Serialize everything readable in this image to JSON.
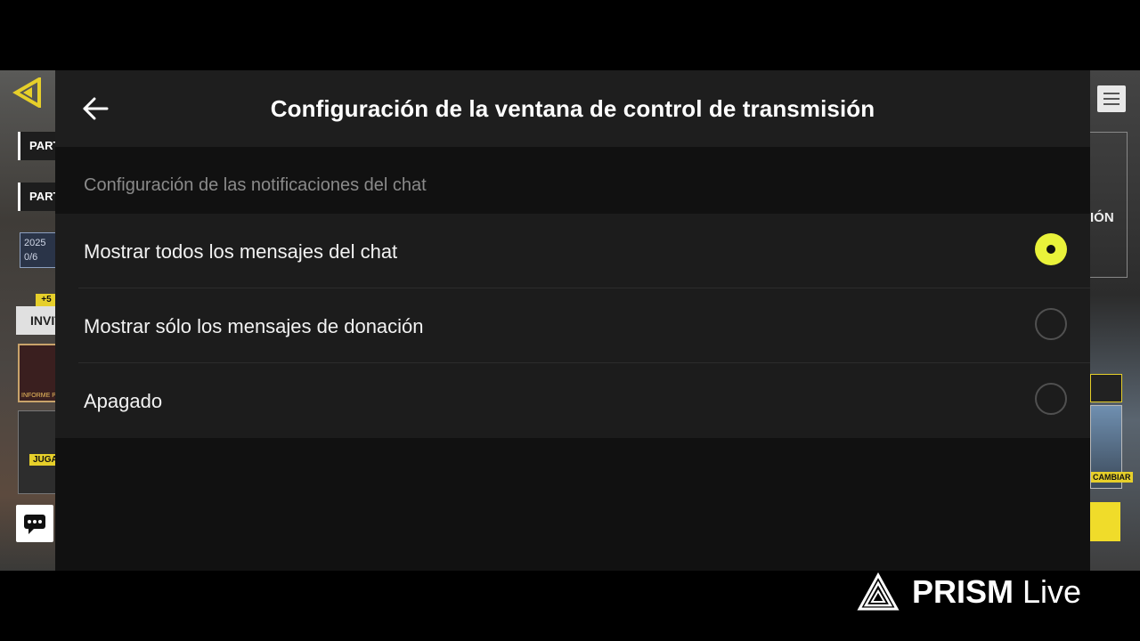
{
  "header": {
    "title": "Configuración de la ventana de control de transmisión",
    "back_icon": "arrow-left-icon"
  },
  "section": {
    "label": "Configuración de las notificaciones del chat"
  },
  "options": [
    {
      "label": "Mostrar todos los mensajes del chat",
      "selected": true
    },
    {
      "label": "Mostrar sólo los mensajes de donación",
      "selected": false
    },
    {
      "label": "Apagado",
      "selected": false
    }
  ],
  "colors": {
    "accent": "#e9f23a",
    "panel_bg": "#111111",
    "header_bg": "#1e1e1e",
    "row_bg": "#1c1c1c"
  },
  "background_game": {
    "left": {
      "pill_1": "PART",
      "pill_2": "PARTI",
      "year": "2025",
      "progress": "0/6",
      "plus": "+5",
      "invite": "INVITA",
      "card_1_caption": "INFORME PR",
      "card_2_tag": "JUGA"
    },
    "right": {
      "partial_text": "IÓN",
      "card_tag": "CAMBIAR"
    }
  },
  "watermark": {
    "brand_bold": "PRISM",
    "brand_light": "Live"
  }
}
